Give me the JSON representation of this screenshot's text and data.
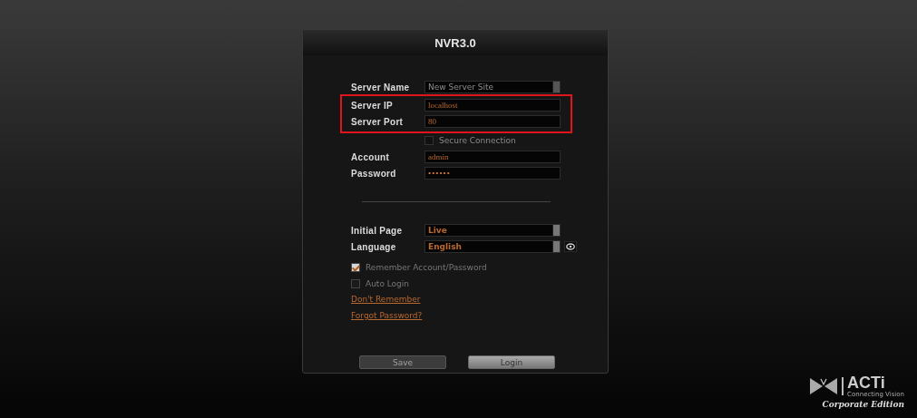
{
  "window": {
    "title": "NVR3.0"
  },
  "server_fields": [
    {
      "label": "Server Name",
      "kind": "select",
      "placeholder": "New Server Site",
      "disabled": true,
      "highlighted": false
    },
    {
      "label": "Server IP",
      "kind": "text",
      "value": "localhost",
      "disabled": false,
      "highlighted": true
    },
    {
      "label": "Server Port",
      "kind": "text",
      "value": "80",
      "disabled": false,
      "highlighted": true
    },
    {
      "label": "Secure Connection",
      "kind": "checkbox",
      "checked": false,
      "disabled": true,
      "highlighted": false
    },
    {
      "label": "Account",
      "kind": "text",
      "value": "admin",
      "disabled": false,
      "highlighted": false
    },
    {
      "label": "Password",
      "kind": "password",
      "value": "••••••",
      "disabled": false,
      "highlighted": false
    }
  ],
  "options": [
    {
      "label": "Initial Page",
      "kind": "select",
      "value": "Live",
      "action_icon": false
    },
    {
      "label": "Language",
      "kind": "select",
      "value": "English",
      "action_icon": true
    }
  ],
  "checkboxes": [
    {
      "label": "Remember Account/Password",
      "checked": true
    },
    {
      "label": "Auto Login",
      "checked": false
    }
  ],
  "links": [
    "Don't Remember",
    "Forgot Password?"
  ],
  "buttons": [
    {
      "label": "Save",
      "disabled": true
    },
    {
      "label": "Login",
      "disabled": false
    }
  ],
  "logo": {
    "name": "ACTi",
    "tagline": "Connecting Vision",
    "edition": "Corporate Edition"
  }
}
